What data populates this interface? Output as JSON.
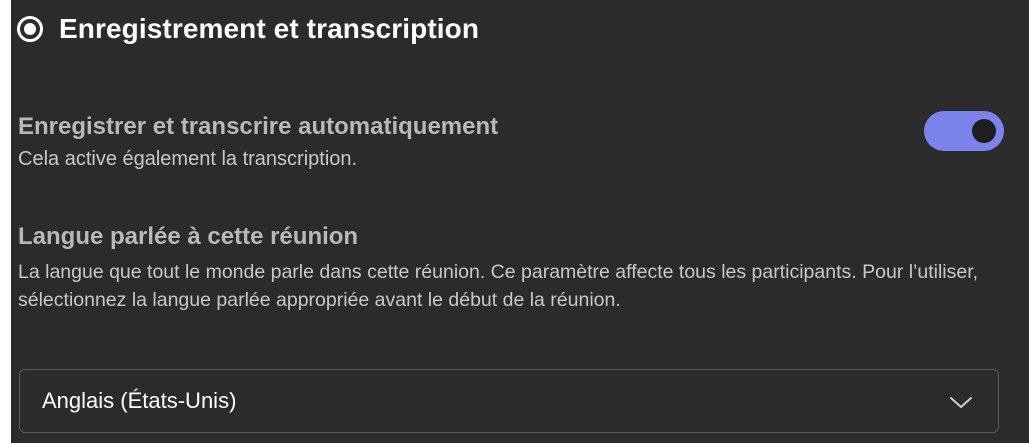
{
  "section": {
    "title": "Enregistrement et transcription"
  },
  "auto_record": {
    "title": "Enregistrer et transcrire automatiquement",
    "description": "Cela active également la transcription.",
    "enabled": true
  },
  "language": {
    "title": "Langue parlée à cette réunion",
    "description": "La langue que tout le monde parle dans cette réunion. Ce paramètre affecte tous les participants. Pour l’utiliser, sélectionnez la langue parlée appropriée avant le début de la réunion.",
    "selected_value": "Anglais (États-Unis)"
  },
  "colors": {
    "background": "#2b2b2b",
    "toggle_on": "#7b83eb",
    "text_primary": "#ffffff",
    "text_secondary": "#c8c8c8"
  },
  "icons": {
    "section": "radio-selected-icon",
    "dropdown": "chevron-down-icon"
  }
}
